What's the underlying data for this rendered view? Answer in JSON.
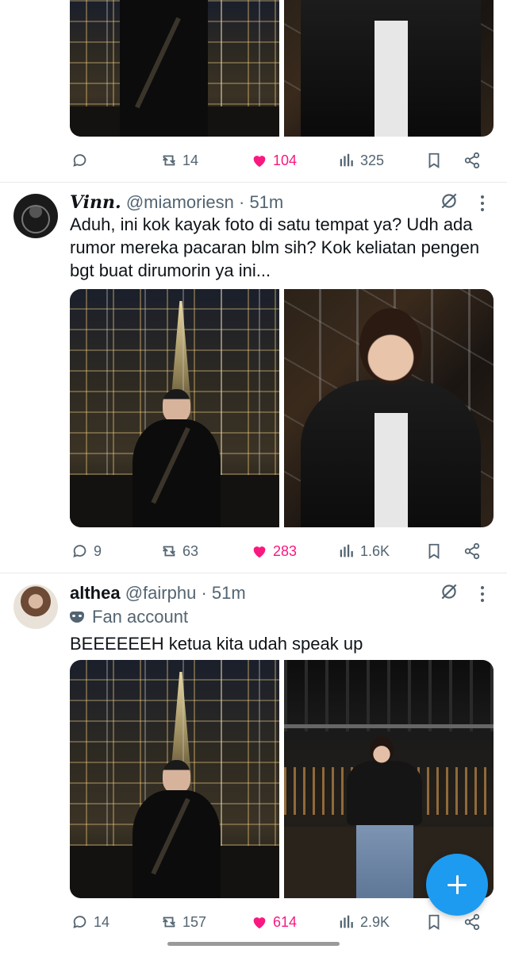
{
  "tweets": [
    {
      "actions": {
        "replies": "",
        "retweets": "14",
        "likes": "104",
        "views": "325"
      }
    },
    {
      "display_name": "Vinn.",
      "handle": "@miamoriesn",
      "separator": "·",
      "time": "51m",
      "text": "Aduh, ini kok kayak foto di satu tempat ya? Udh ada rumor mereka pacaran blm sih? Kok keliatan pengen bgt buat dirumorin ya ini...",
      "actions": {
        "replies": "9",
        "retweets": "63",
        "likes": "283",
        "views": "1.6K"
      }
    },
    {
      "display_name": "althea",
      "handle": "@fairphu",
      "separator": "·",
      "time": "51m",
      "label": "Fan account",
      "text": "BEEEEEEH ketua kita udah speak up",
      "actions": {
        "replies": "14",
        "retweets": "157",
        "likes": "614",
        "views": "2.9K"
      }
    }
  ],
  "colors": {
    "accent": "#1d9bf0",
    "like": "#f91880",
    "muted": "#536471",
    "text": "#0f1419"
  },
  "icons": {
    "reply": "reply-icon",
    "retweet": "retweet-icon",
    "like": "heart-icon",
    "views": "views-icon",
    "bookmark": "bookmark-icon",
    "share": "share-icon",
    "grok": "grok-icon",
    "more": "more-icon",
    "compose": "compose-plus-icon"
  }
}
